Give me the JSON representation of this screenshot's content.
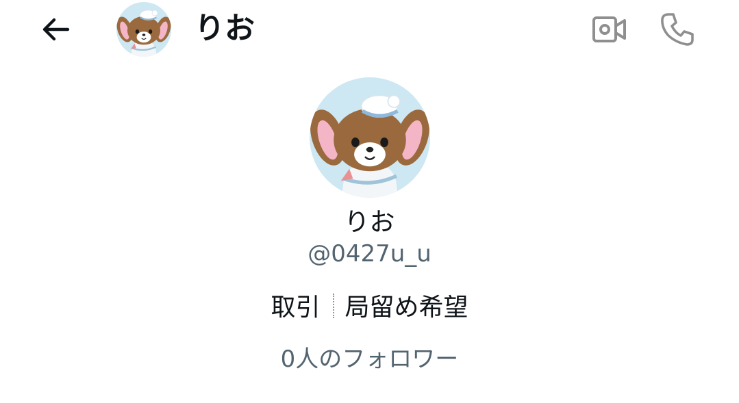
{
  "header": {
    "back_icon": "arrow-left-icon",
    "name": "りお",
    "video_icon": "video-camera-icon",
    "call_icon": "phone-icon"
  },
  "profile": {
    "name": "りお",
    "handle": "@0427u_u",
    "bio_part1": "取引",
    "bio_part2": "局留め希望",
    "followers": "0人のフォロワー"
  },
  "colors": {
    "text_primary": "#0f1419",
    "text_secondary": "#536471",
    "icon_gray": "#8f8f8f",
    "avatar_bg": "#cde7f3"
  }
}
